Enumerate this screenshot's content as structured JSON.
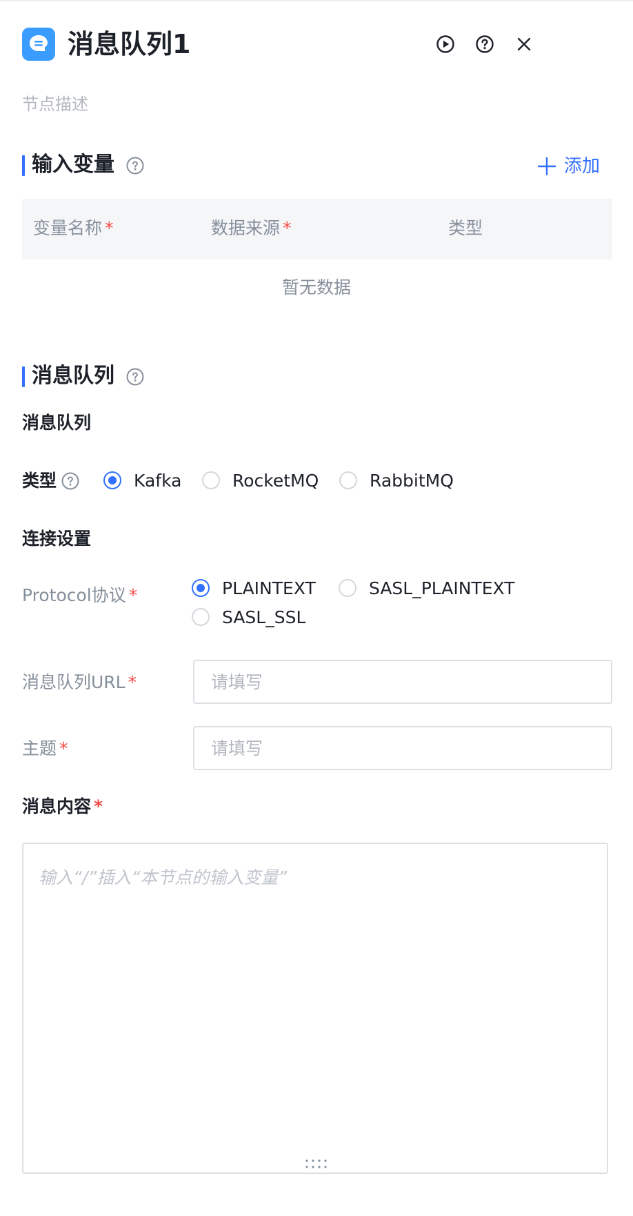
{
  "header": {
    "title": "消息队列1",
    "app_icon": "chat-bubble-icon",
    "run_icon": "play-circle-icon",
    "help_icon": "question-circle-icon",
    "close_icon": "close-icon",
    "icon_color": "#3b9cff"
  },
  "node_description_placeholder": "节点描述",
  "input_variables": {
    "title": "输入变量",
    "add_label": "添加",
    "columns": [
      {
        "label": "变量名称",
        "required": "*"
      },
      {
        "label": "数据来源",
        "required": "*"
      },
      {
        "label": "类型",
        "required": ""
      }
    ],
    "empty_text": "暂无数据"
  },
  "message_queue": {
    "title": "消息队列",
    "subheading": "消息队列",
    "type_label": "类型",
    "type_options": [
      "Kafka",
      "RocketMQ",
      "RabbitMQ"
    ],
    "type_selected": "Kafka",
    "connection_heading": "连接设置",
    "protocol_label": "Protocol协议",
    "protocol_options": [
      "PLAINTEXT",
      "SASL_PLAINTEXT",
      "SASL_SSL"
    ],
    "protocol_selected": "PLAINTEXT",
    "url_label": "消息队列URL",
    "url_placeholder": "请填写",
    "url_value": "",
    "topic_label": "主题",
    "topic_placeholder": "请填写",
    "topic_value": "",
    "content_label": "消息内容",
    "content_placeholder": "输入“/”插入“本节点的输入变量”",
    "required_mark": "*"
  },
  "colors": {
    "accent": "#3370ff",
    "required": "#f54a45"
  }
}
